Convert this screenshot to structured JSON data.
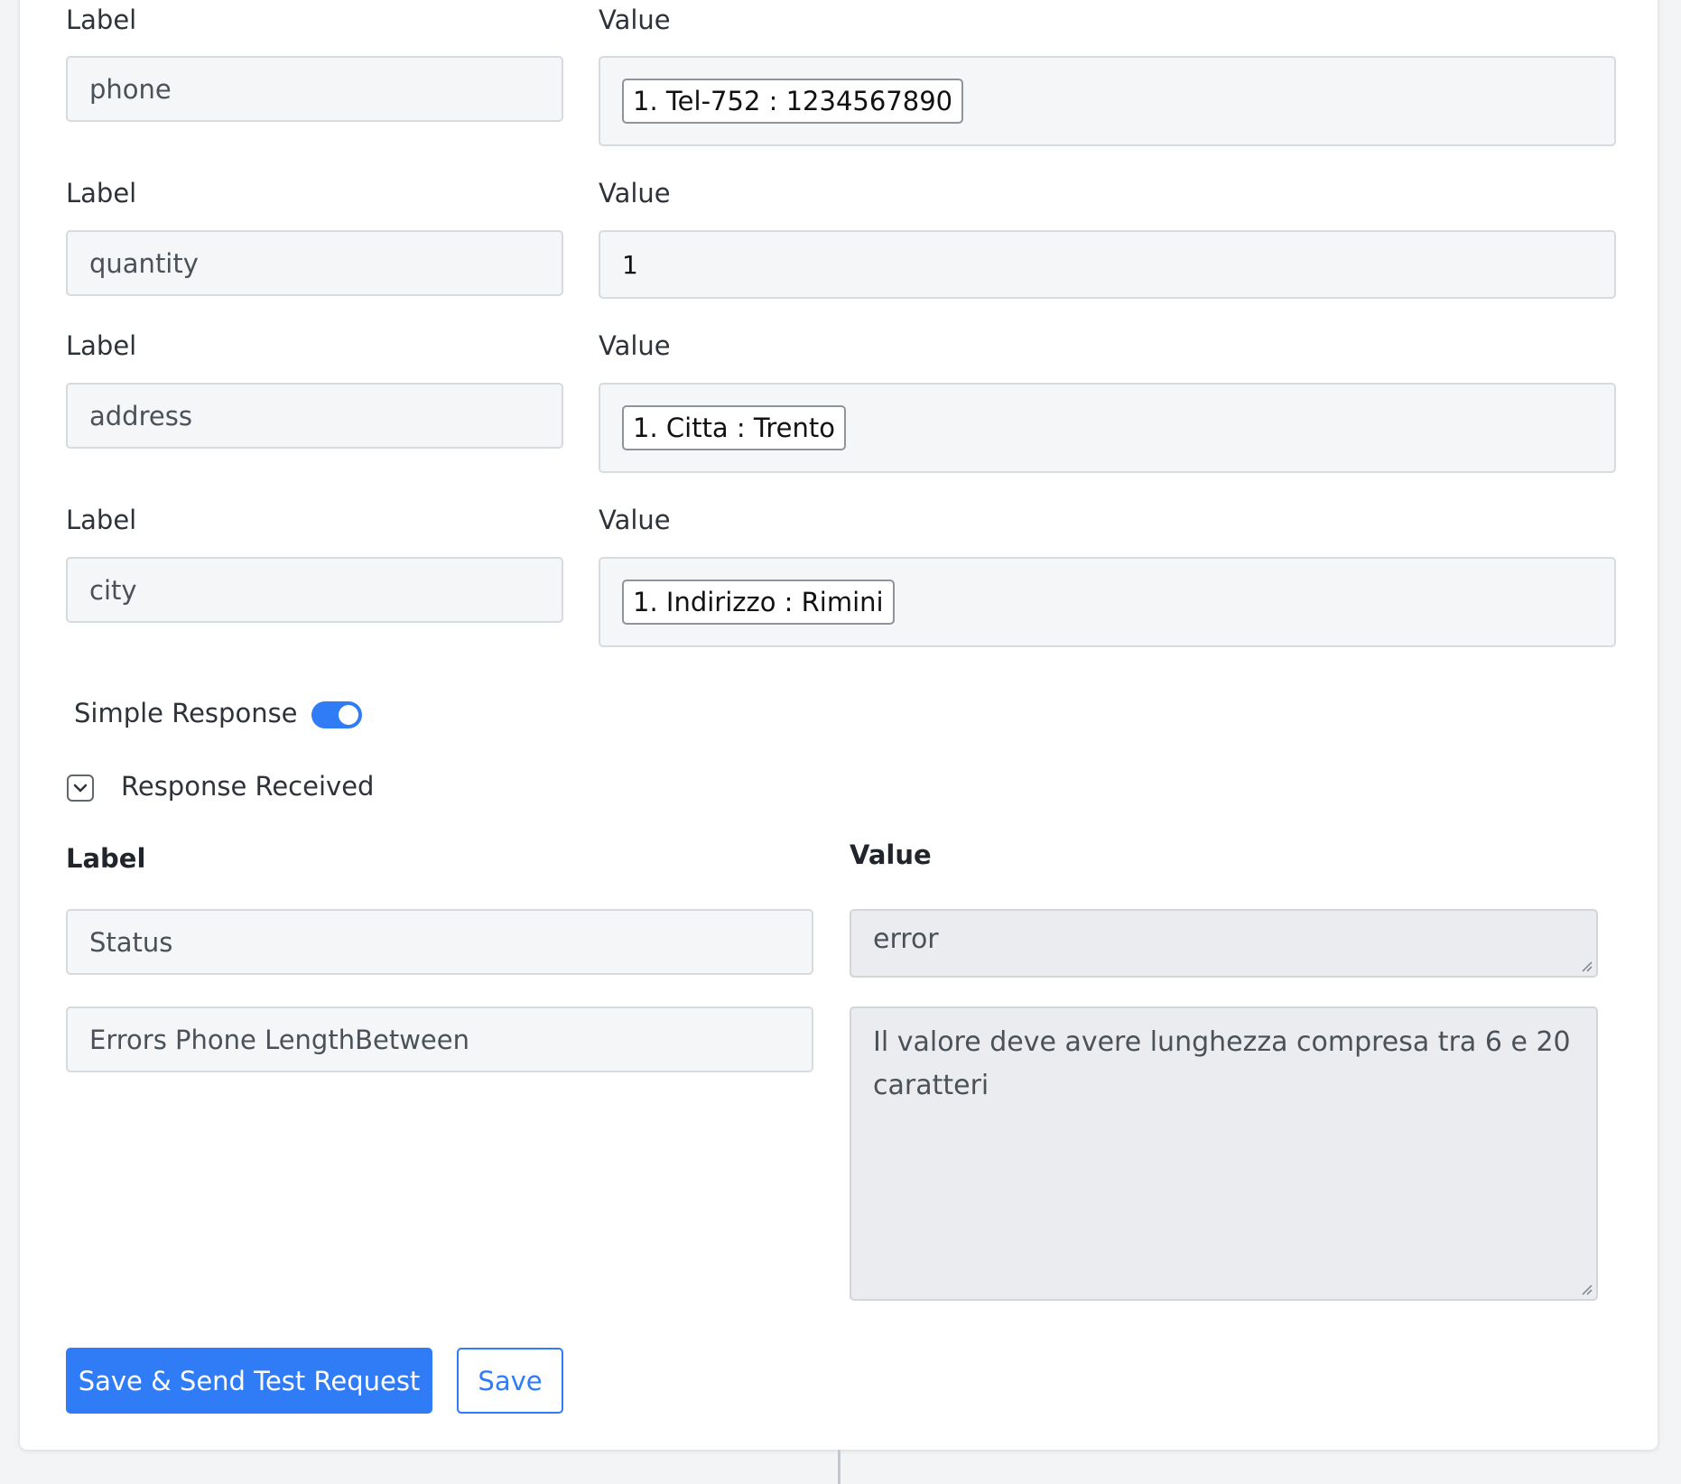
{
  "mapping_rows": [
    {
      "label_heading": "Label",
      "value_heading": "Value",
      "label_value": "phone",
      "value_chip": "1. Tel-752 : 1234567890"
    },
    {
      "label_heading": "Label",
      "value_heading": "Value",
      "label_value": "quantity",
      "value_text": "1"
    },
    {
      "label_heading": "Label",
      "value_heading": "Value",
      "label_value": "address",
      "value_chip": "1. Citta : Trento"
    },
    {
      "label_heading": "Label",
      "value_heading": "Value",
      "label_value": "city",
      "value_chip": "1. Indirizzo : Rimini"
    }
  ],
  "simple_response": {
    "label": "Simple Response",
    "enabled": true
  },
  "response_received": {
    "label": "Response Received",
    "label_heading": "Label",
    "value_heading": "Value",
    "rows": [
      {
        "label": "Status",
        "value": "error"
      },
      {
        "label": "Errors Phone LengthBetween",
        "value": "Il valore deve avere lunghezza compresa tra 6 e 20 caratteri"
      }
    ]
  },
  "actions": {
    "save_send_label": "Save & Send Test Request",
    "save_label": "Save"
  },
  "colors": {
    "primary": "#2f7cf6",
    "input_bg": "#f4f6f8",
    "readonly_bg": "#eaecef",
    "border": "#d6dbe0"
  }
}
